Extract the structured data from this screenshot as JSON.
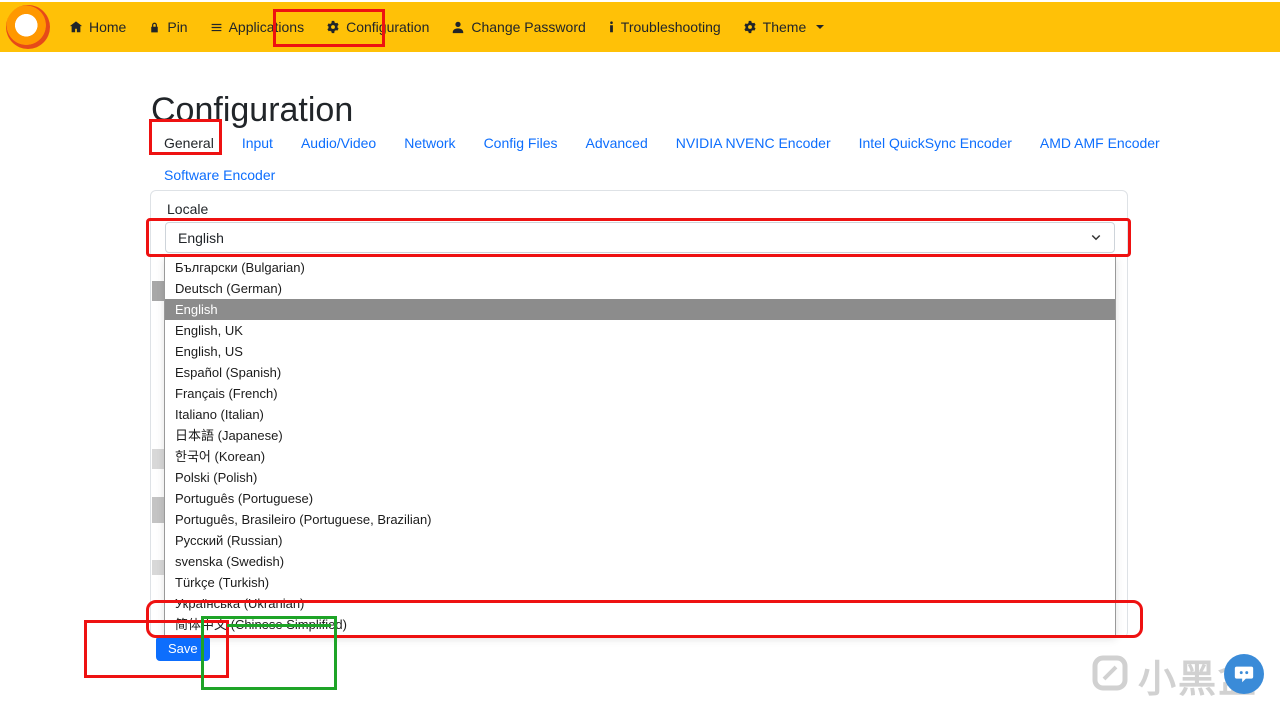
{
  "navbar": {
    "items": [
      {
        "label": "Home",
        "icon": "home-icon"
      },
      {
        "label": "Pin",
        "icon": "lock-icon"
      },
      {
        "label": "Applications",
        "icon": "list-icon"
      },
      {
        "label": "Configuration",
        "icon": "gear-icon"
      },
      {
        "label": "Change Password",
        "icon": "user-icon"
      },
      {
        "label": "Troubleshooting",
        "icon": "info-icon"
      },
      {
        "label": "Theme",
        "icon": "gear-icon"
      }
    ]
  },
  "page": {
    "title": "Configuration"
  },
  "tabs": {
    "active": "General",
    "items": [
      "General",
      "Input",
      "Audio/Video",
      "Network",
      "Config Files",
      "Advanced",
      "NVIDIA NVENC Encoder",
      "Intel QuickSync Encoder",
      "AMD AMF Encoder",
      "Software Encoder"
    ]
  },
  "form": {
    "locale_label": "Locale",
    "select_value": "English",
    "save_label": "Save"
  },
  "dropdown": {
    "selected": "English",
    "selected_index": 2,
    "options": [
      "Български (Bulgarian)",
      "Deutsch (German)",
      "English",
      "English, UK",
      "English, US",
      "Español (Spanish)",
      "Français (French)",
      "Italiano (Italian)",
      "日本語 (Japanese)",
      "한국어 (Korean)",
      "Polski (Polish)",
      "Português (Portuguese)",
      "Português, Brasileiro (Portuguese, Brazilian)",
      "Русский (Russian)",
      "svenska (Swedish)",
      "Türkçe (Turkish)",
      "Українська (Ukranian)",
      "简体中文 (Chinese Simplified)"
    ]
  },
  "watermark": {
    "text": "小黑盒"
  },
  "colors": {
    "navbar": "#ffc107",
    "accent": "#0d6efd",
    "annotation_red": "#ee1111",
    "annotation_green": "#1ea427",
    "highlight_gray": "#8c8c8c",
    "chat_bubble_blue": "#3a8bd8"
  }
}
